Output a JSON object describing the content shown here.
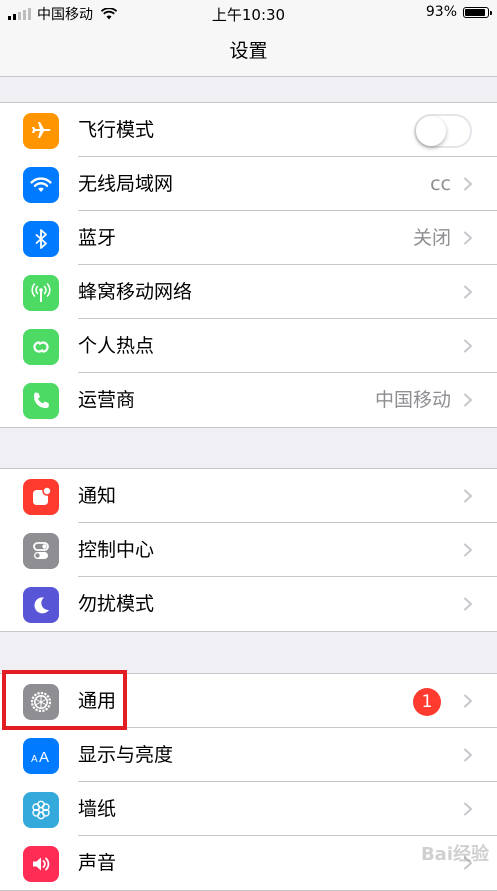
{
  "status_bar": {
    "carrier": "中国移动",
    "time": "上午10:30",
    "battery": "93%",
    "battery_level": 0.93,
    "signal_bars": 2
  },
  "nav": {
    "title": "设置"
  },
  "groups": [
    {
      "rows": [
        {
          "label": "飞行模式",
          "icon": "airplane-icon",
          "color": "#ff9500",
          "toggle": false
        },
        {
          "label": "无线局域网",
          "icon": "wifi-icon",
          "color": "#007aff",
          "value": "cc"
        },
        {
          "label": "蓝牙",
          "icon": "bluetooth-icon",
          "color": "#007aff",
          "value": "关闭"
        },
        {
          "label": "蜂窝移动网络",
          "icon": "antenna-icon",
          "color": "#4cd964"
        },
        {
          "label": "个人热点",
          "icon": "hotspot-icon",
          "color": "#4cd964"
        },
        {
          "label": "运营商",
          "icon": "phone-icon",
          "color": "#4cd964",
          "value": "中国移动"
        }
      ]
    },
    {
      "rows": [
        {
          "label": "通知",
          "icon": "notifications-icon",
          "color": "#ff3b30"
        },
        {
          "label": "控制中心",
          "icon": "control-center-icon",
          "color": "#8e8e93"
        },
        {
          "label": "勿扰模式",
          "icon": "moon-icon",
          "color": "#5856d6"
        }
      ]
    },
    {
      "rows": [
        {
          "label": "通用",
          "icon": "gear-icon",
          "color": "#8e8e93",
          "badge": "1"
        },
        {
          "label": "显示与亮度",
          "icon": "text-size-icon",
          "color": "#007aff"
        },
        {
          "label": "墙纸",
          "icon": "wallpaper-icon",
          "color": "#34aadc"
        },
        {
          "label": "声音",
          "icon": "speaker-icon",
          "color": "#ff2d55"
        }
      ]
    }
  ],
  "watermark": "Bai经验"
}
